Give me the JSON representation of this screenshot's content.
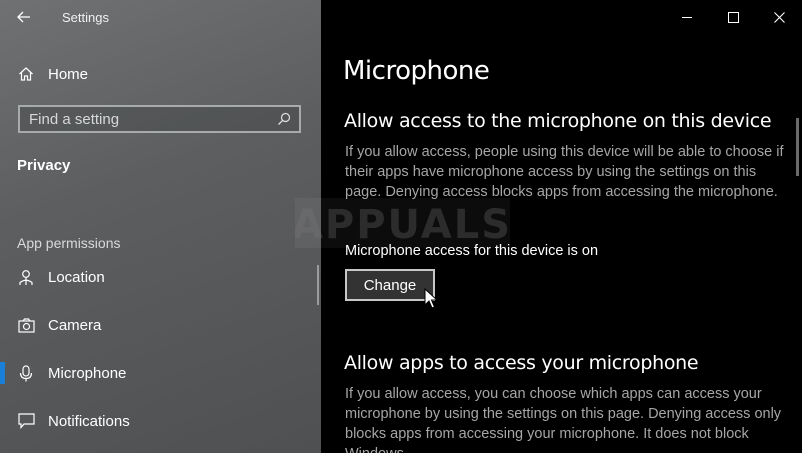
{
  "window": {
    "app_title": "Settings"
  },
  "sidebar": {
    "home_label": "Home",
    "search_placeholder": "Find a setting",
    "section_title": "Privacy",
    "group_label": "App permissions",
    "items": [
      {
        "label": "Location",
        "icon": "location-icon"
      },
      {
        "label": "Camera",
        "icon": "camera-icon"
      },
      {
        "label": "Microphone",
        "icon": "microphone-icon",
        "selected": true
      },
      {
        "label": "Notifications",
        "icon": "notifications-icon"
      }
    ]
  },
  "main": {
    "title": "Microphone",
    "device_section": {
      "heading": "Allow access to the microphone on this device",
      "description": "If you allow access, people using this device will be able to choose if their apps have microphone access by using the settings on this page. Denying access blocks apps from accessing the microphone.",
      "status": "Microphone access for this device is on",
      "button_label": "Change"
    },
    "apps_section": {
      "heading": "Allow apps to access your microphone",
      "description": "If you allow access, you can choose which apps can access your microphone by using the settings on this page. Denying access only blocks apps from accessing your microphone. It does not block Windows."
    }
  },
  "watermark": "APPUALS",
  "colors": {
    "sidebar_bg": "#5f6163",
    "main_bg": "#000000",
    "accent": "#1a7fd6",
    "description_text": "#a6a6a6"
  }
}
